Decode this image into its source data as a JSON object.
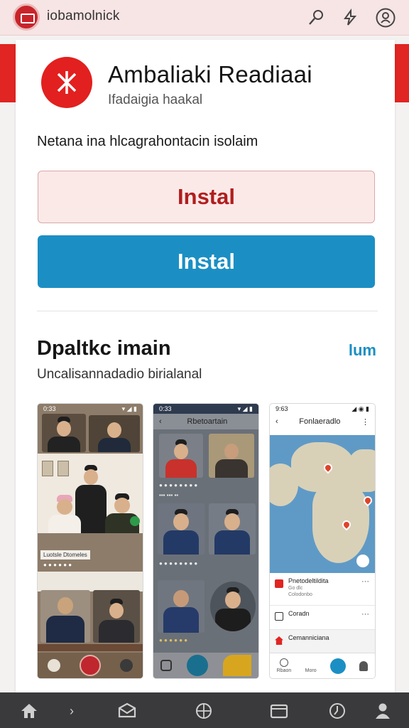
{
  "header": {
    "title": "iobamolnick",
    "icons": [
      "app-logo-icon",
      "pen-icon",
      "lightning-icon",
      "profile-icon"
    ]
  },
  "app": {
    "name": "Ambaliaki Readiaai",
    "subtitle": "Ifadaigia haakal",
    "description": "Netana ina hlcagrahontacin isolaim",
    "install_outline_label": "Instal",
    "install_primary_label": "Instal"
  },
  "screenshots_section": {
    "title": "Dpaltkc imain",
    "link": "lum",
    "subtitle": "Uncalisannadadio birialanal"
  },
  "screenshots": [
    {
      "time": "0:33",
      "signal": "▾ ◢ ▮",
      "caption": "Luotsle Dtomeles",
      "dots": "● ● ● ●  ● ●"
    },
    {
      "time": "0:33",
      "signal": "▾ ◢ ▮",
      "header": "Rbetoartain",
      "dots": "● ● ● ●   ● ● ● ●"
    },
    {
      "time": "9:63",
      "signal": "◢ ◉ ▮",
      "header": "Fonlaeradlo",
      "items": [
        {
          "title": "Pnetodeltildita",
          "sub1": "Go dlc",
          "sub2": "Colodonbo"
        },
        {
          "title": "Coradn",
          "sub1": ""
        },
        {
          "title": "Cemanniciana",
          "sub1": ""
        }
      ],
      "nav_labels": [
        "Rbaon",
        "Moro",
        "",
        ""
      ]
    }
  ],
  "bottom_nav": {
    "items": [
      "home-icon",
      "chevron-right-icon",
      "inbox-icon",
      "globe-icon",
      "window-icon",
      "clock-icon",
      "person-icon"
    ]
  },
  "colors": {
    "brand_red": "#e02522",
    "accent_blue": "#1b8fc4",
    "nav_dark": "#3a3a3c"
  }
}
